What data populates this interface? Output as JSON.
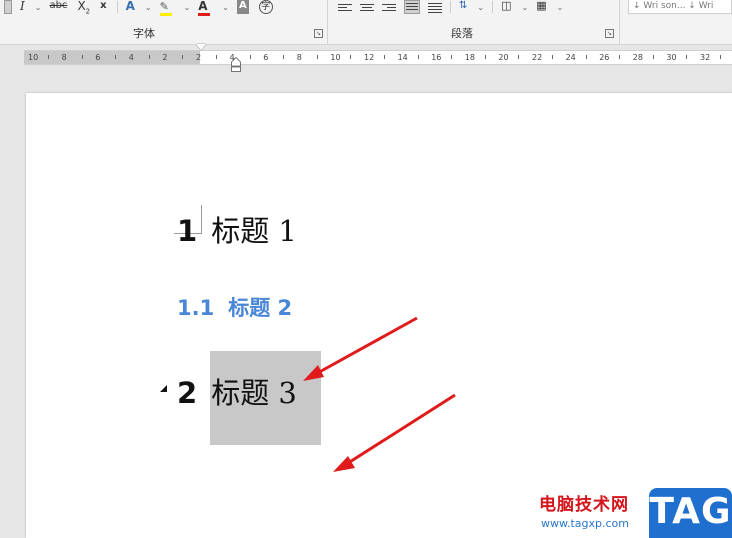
{
  "ribbon": {
    "font_group_label": "字体",
    "paragraph_group_label": "段落",
    "style_gallery_text": "↓ Wri son...  ↓ Wri",
    "font_tools": {
      "italic": "I",
      "strikethrough": "abc",
      "subscript": "X",
      "subscript_mark": "2",
      "clear": "x",
      "text_effect": "A",
      "font_color": "A",
      "char_shading": "A",
      "enclose": "字"
    }
  },
  "ruler": {
    "labels": [
      "10",
      "8",
      "6",
      "4",
      "2",
      "2",
      "4",
      "6",
      "8",
      "10",
      "12",
      "14",
      "16",
      "18",
      "20",
      "22",
      "24",
      "26",
      "28",
      "30",
      "32"
    ]
  },
  "document": {
    "heading1": {
      "number": "1",
      "text": "标题 1"
    },
    "heading2": {
      "number": "1.1",
      "text": "标题 2"
    },
    "heading3": {
      "number": "2",
      "text": "标题 3"
    }
  },
  "watermark": {
    "title": "电脑技术网",
    "url": "www.tagxp.com",
    "tag": "TAG"
  },
  "colors": {
    "heading2": "#4a86d8",
    "arrow": "#e01b1b",
    "watermark_red": "#d4141b",
    "watermark_blue": "#1f6fcf"
  }
}
